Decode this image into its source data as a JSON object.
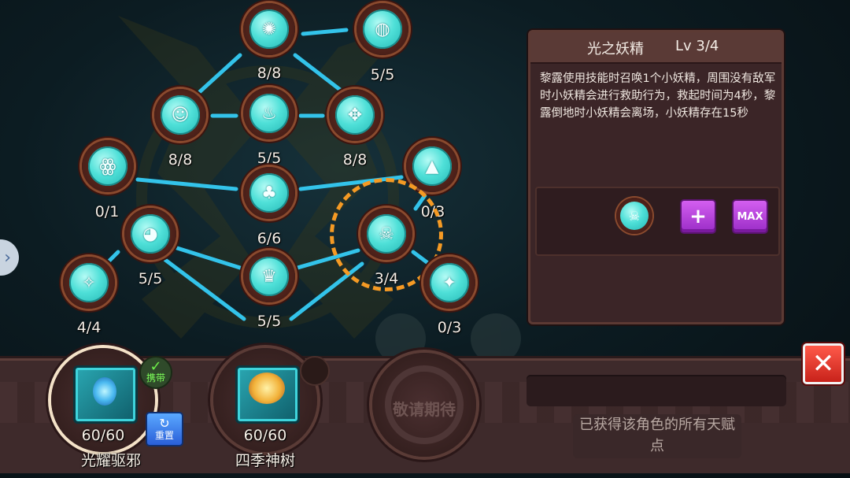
{
  "talent_tree": {
    "nodes": [
      {
        "id": "n-top-1",
        "icon": "lotus-crown-icon",
        "glyph": "✺",
        "level": "8/8"
      },
      {
        "id": "n-top-2",
        "icon": "shield-heart-icon",
        "glyph": "◍",
        "level": "5/5"
      },
      {
        "id": "n-r2-1",
        "icon": "figure-rings-icon",
        "glyph": "☺",
        "level": "8/8"
      },
      {
        "id": "n-r2-2",
        "icon": "chalice-icon",
        "glyph": "♨",
        "level": "5/5"
      },
      {
        "id": "n-r2-3",
        "icon": "cross-gem-icon",
        "glyph": "✥",
        "level": "8/8"
      },
      {
        "id": "n-r3-1",
        "icon": "spiral-figure-icon",
        "glyph": "ꙮ",
        "level": "0/1"
      },
      {
        "id": "n-r3-2",
        "icon": "trefoil-icon",
        "glyph": "♣",
        "level": "6/6"
      },
      {
        "id": "n-r3-3",
        "icon": "pyramid-eye-icon",
        "glyph": "▲",
        "level": "0/3"
      },
      {
        "id": "n-r4-1",
        "icon": "owl-icon",
        "glyph": "◕",
        "level": "5/5"
      },
      {
        "id": "n-r4-2",
        "icon": "fairy-icon",
        "glyph": "☠",
        "level": "3/4",
        "selected": true
      },
      {
        "id": "n-r5-1",
        "icon": "rune-cross-icon",
        "glyph": "✧",
        "level": "4/4"
      },
      {
        "id": "n-r5-2",
        "icon": "crown-circle-icon",
        "glyph": "♛",
        "level": "5/5"
      },
      {
        "id": "n-r5-3",
        "icon": "sparkle-skull-icon",
        "glyph": "✦",
        "level": "0/3"
      }
    ]
  },
  "info_panel": {
    "name": "光之妖精",
    "level": "Lv 3/4",
    "description": "黎露使用技能时召唤1个小妖精，周围没有敌军时小妖精会进行救助行为，救起时间为4秒，黎露倒地时小妖精会离场，小妖精存在15秒",
    "plus_label": "+",
    "max_label": "MAX"
  },
  "bottom_bar": {
    "slots": [
      {
        "count": "60/60",
        "name": "光耀驱邪"
      },
      {
        "count": "60/60",
        "name": "四季神树"
      }
    ],
    "carry_label": "携带",
    "reset_label": "重置",
    "locked_label": "敬请期待",
    "status_note": "已获得该角色的所有天赋点"
  },
  "colors": {
    "node_core": "#4fe0d8",
    "selection": "#f59a24",
    "panel_bg": "#3b2527",
    "purple_button": "#b844e0",
    "close_red": "#e23a2c"
  }
}
